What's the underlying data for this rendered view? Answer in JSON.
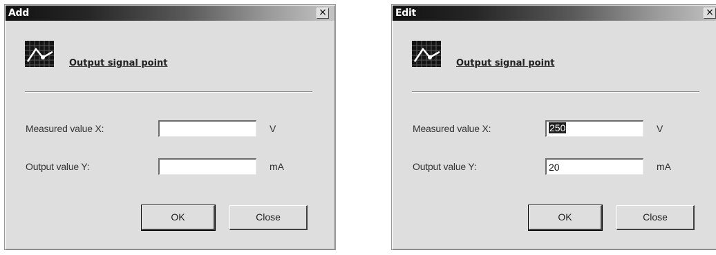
{
  "colors": {
    "dialog_bg": "#dedede",
    "titlebar_dark": "#111111",
    "titlebar_light": "#c4c4c4",
    "input_bg": "#ffffff",
    "selection_bg": "#202020"
  },
  "dialogs": [
    {
      "title": "Add",
      "close_glyph": "×",
      "icon": "chart-icon",
      "heading": "Output signal point",
      "fields": {
        "x": {
          "label": "Measured value X:",
          "value": "",
          "unit": "V"
        },
        "y": {
          "label": "Output value Y:",
          "value": "",
          "unit": "mA"
        }
      },
      "buttons": {
        "ok": "OK",
        "close": "Close"
      }
    },
    {
      "title": "Edit",
      "close_glyph": "×",
      "icon": "chart-icon",
      "heading": "Output signal point",
      "fields": {
        "x": {
          "label": "Measured value X:",
          "value": "250",
          "unit": "V",
          "selected": true
        },
        "y": {
          "label": "Output value Y:",
          "value": "20",
          "unit": "mA"
        }
      },
      "buttons": {
        "ok": "OK",
        "close": "Close"
      }
    }
  ]
}
